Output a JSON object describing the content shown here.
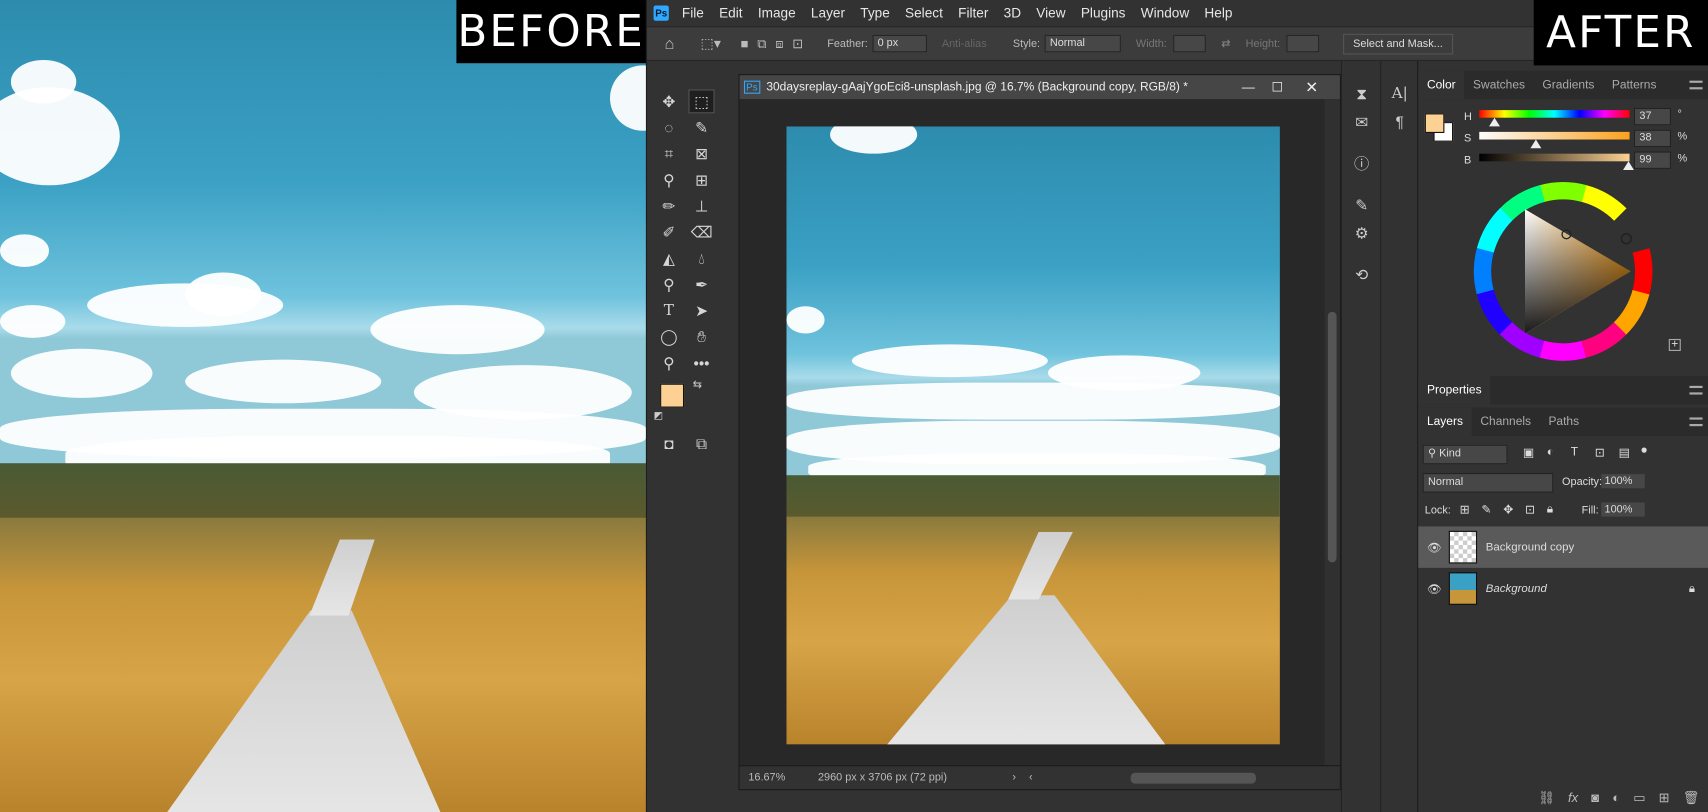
{
  "labels": {
    "before": "BEFORE",
    "after": "AFTER"
  },
  "menu": [
    "File",
    "Edit",
    "Image",
    "Layer",
    "Type",
    "Select",
    "Filter",
    "3D",
    "View",
    "Plugins",
    "Window",
    "Help"
  ],
  "app_logo": "Ps",
  "options": {
    "feather_label": "Feather:",
    "feather_value": "0 px",
    "antialias": "Anti-alias",
    "style_label": "Style:",
    "style_value": "Normal",
    "width_label": "Width:",
    "height_label": "Height:",
    "select_mask": "Select and Mask..."
  },
  "document": {
    "title": "30daysreplay-gAajYgoEci8-unsplash.jpg @ 16.7% (Background copy, RGB/8) *",
    "zoom": "16.67%",
    "info": "2960 px x 3706 px (72 ppi)"
  },
  "color_panel": {
    "tabs": [
      "Color",
      "Swatches",
      "Gradients",
      "Patterns"
    ],
    "h_label": "H",
    "s_label": "S",
    "b_label": "B",
    "h": "37",
    "s": "38",
    "b": "99",
    "deg": "°",
    "pct": "%",
    "h_level": 0.1,
    "s_level": 0.38,
    "b_level": 0.99,
    "foreground": "#fcd193",
    "background": "#ffffff"
  },
  "properties": {
    "title": "Properties"
  },
  "layers_panel": {
    "tabs": [
      "Layers",
      "Channels",
      "Paths"
    ],
    "kind": "Kind",
    "blend": "Normal",
    "opacity_label": "Opacity:",
    "opacity": "100%",
    "lock_label": "Lock:",
    "fill_label": "Fill:",
    "fill": "100%",
    "layers": [
      {
        "name": "Background copy",
        "selected": true
      },
      {
        "name": "Background",
        "locked": true
      }
    ]
  }
}
